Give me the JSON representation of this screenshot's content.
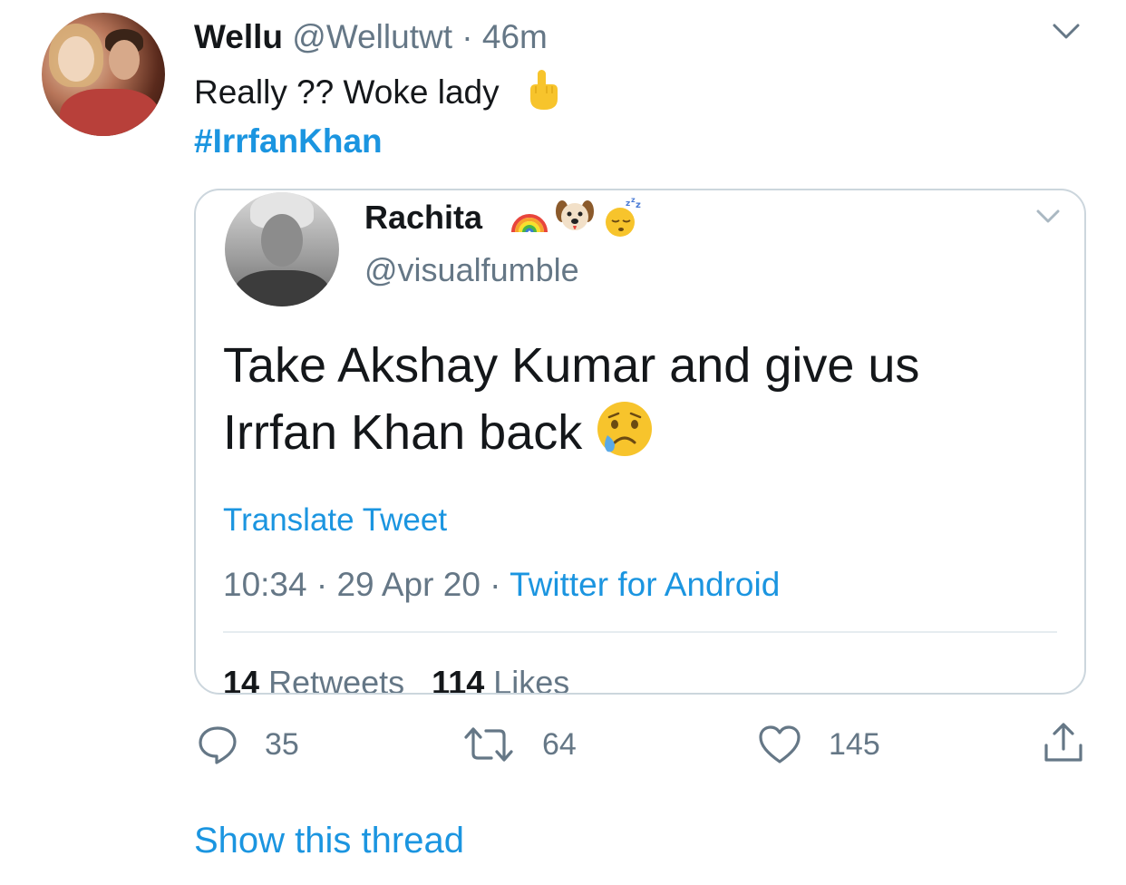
{
  "tweet": {
    "display_name": "Wellu",
    "handle": "@Wellutwt",
    "separator": "·",
    "time": "46m",
    "text": "Really ?? Woke lady",
    "hashtag": "#IrrfanKhan",
    "show_thread_label": "Show this thread"
  },
  "quoted": {
    "display_name": "Rachita",
    "name_emojis": [
      "rainbow-icon",
      "dog-face-icon",
      "sleeping-face-icon"
    ],
    "handle": "@visualfumble",
    "text_line1": "Take Akshay Kumar and give us",
    "text_line2": "Irrfan Khan back",
    "translate_label": "Translate Tweet",
    "time": "10:34",
    "separator": "·",
    "date": "29 Apr 20",
    "source": "Twitter for Android",
    "retweets_count": "14",
    "retweets_label": "Retweets",
    "likes_count": "114",
    "likes_label": "Likes"
  },
  "actions": {
    "reply_count": "35",
    "retweet_count": "64",
    "like_count": "145"
  },
  "colors": {
    "link_blue": "#1b95e0",
    "muted_gray": "#657786",
    "text_dark": "#14171a",
    "border": "#ccd6dd"
  }
}
